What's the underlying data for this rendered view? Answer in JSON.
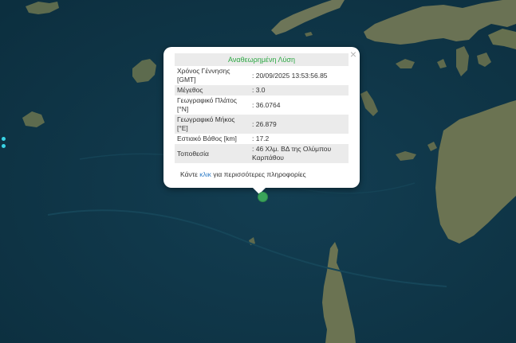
{
  "popup": {
    "title": "Αναθεωρημένη Λύση",
    "close_symbol": "×",
    "rows": [
      {
        "label": "Χρόνος Γέννησης [GMT]",
        "value": ": 20/09/2025 13:53:56.85"
      },
      {
        "label": "Μέγεθος",
        "value": ": 3.0"
      },
      {
        "label": "Γεωγραφικό Πλάτος [°N]",
        "value": ": 36.0764"
      },
      {
        "label": "Γεωγραφικό Μήκος [°E]",
        "value": ": 26.879"
      },
      {
        "label": "Εστιακό Βάθος [km]",
        "value": ": 17.2"
      },
      {
        "label": "Τοποθεσία",
        "value": ": 46 Χλμ. ΒΔ της Ολύμπου Καρπάθου"
      }
    ],
    "more_prefix": "Κάντε ",
    "more_link": "κλικ",
    "more_suffix": " για περισσότερες πληροφορίες",
    "title_color": "#2fa845",
    "link_color": "#2e7cc7"
  },
  "map": {
    "sea_color": "#0f3646",
    "marker_color": "#3aa35a",
    "marker_icon": "earthquake-epicenter-marker"
  }
}
